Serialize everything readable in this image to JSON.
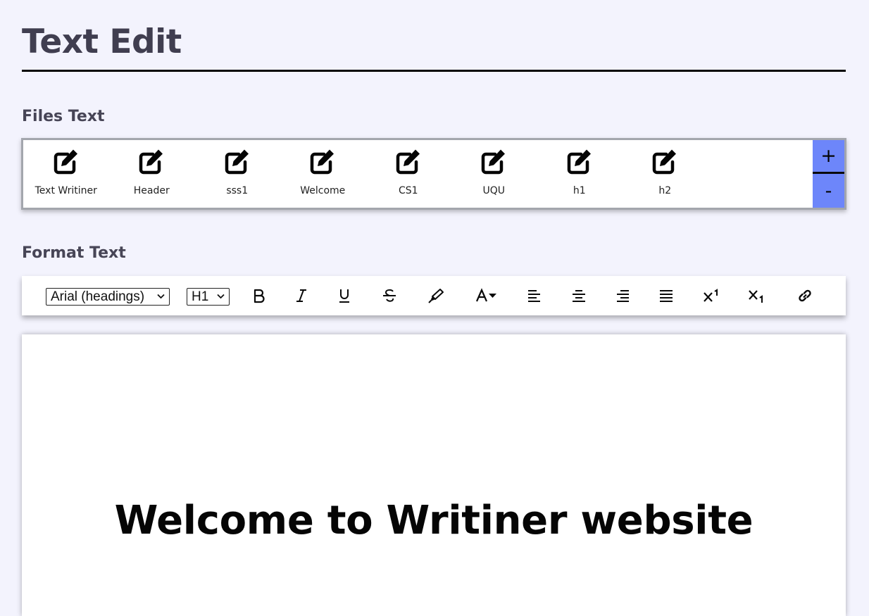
{
  "header": {
    "title": "Text Edit"
  },
  "files_section": {
    "title": "Files Text",
    "files": [
      {
        "label": "Text Writiner",
        "icon": "edit-icon"
      },
      {
        "label": "Header",
        "icon": "edit-icon"
      },
      {
        "label": "sss1",
        "icon": "edit-icon"
      },
      {
        "label": "Welcome",
        "icon": "edit-icon"
      },
      {
        "label": "CS1",
        "icon": "edit-icon"
      },
      {
        "label": "UQU",
        "icon": "edit-icon"
      },
      {
        "label": "h1",
        "icon": "edit-icon"
      },
      {
        "label": "h2",
        "icon": "edit-icon"
      }
    ],
    "add_label": "+",
    "remove_label": "-",
    "button_color": "#6d86fa"
  },
  "format_section": {
    "title": "Format Text",
    "font_select": {
      "value": "Arial (headings)"
    },
    "size_select": {
      "value": "H1"
    },
    "tools": [
      {
        "icon": "bold-icon"
      },
      {
        "icon": "italic-icon"
      },
      {
        "icon": "underline-icon"
      },
      {
        "icon": "strikethrough-icon"
      },
      {
        "icon": "highlighter-icon"
      },
      {
        "icon": "font-color-icon"
      },
      {
        "icon": "align-left-icon"
      },
      {
        "icon": "align-center-icon"
      },
      {
        "icon": "align-right-icon"
      },
      {
        "icon": "align-justify-icon"
      },
      {
        "icon": "superscript-icon"
      },
      {
        "icon": "subscript-icon"
      },
      {
        "icon": "link-icon"
      }
    ]
  },
  "editor": {
    "heading": "Welcome to Writiner website"
  },
  "colors": {
    "background": "#f3f3fd",
    "accent": "#6d86fa"
  }
}
